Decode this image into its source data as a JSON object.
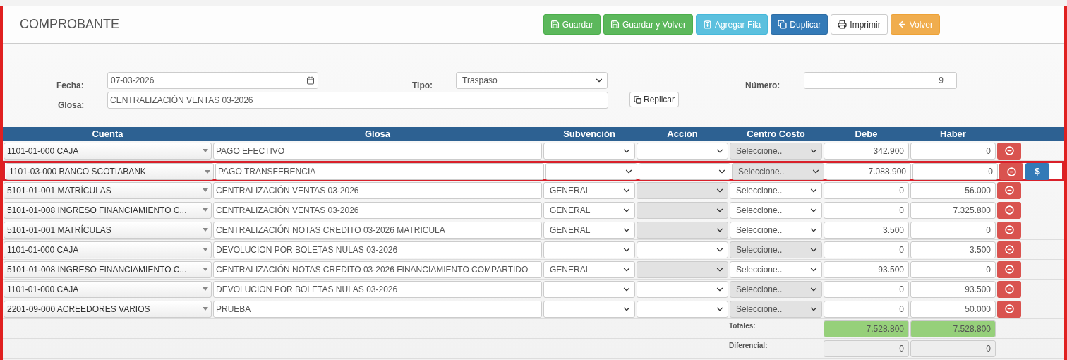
{
  "title": "COMPROBANTE",
  "toolbar": [
    {
      "label": "Guardar",
      "kind": "save"
    },
    {
      "label": "Guardar y Volver",
      "kind": "save"
    },
    {
      "label": "Agregar Fila",
      "kind": "add"
    },
    {
      "label": "Duplicar",
      "kind": "duplicate"
    },
    {
      "label": "Imprimir",
      "kind": "print"
    },
    {
      "label": "Volver",
      "kind": "back"
    }
  ],
  "form": {
    "fecha_label": "Fecha:",
    "fecha": "07-03-2026",
    "tipo_label": "Tipo:",
    "tipo": "Traspaso",
    "numero_label": "Número:",
    "numero": "9",
    "glosa_label": "Glosa:",
    "glosa": "CENTRALIZACIÓN VENTAS 03-2026",
    "replicar": "Replicar"
  },
  "table": {
    "columns": [
      "Cuenta",
      "Glosa",
      "Subvención",
      "Acción",
      "Centro Costo",
      "Debe",
      "Haber"
    ],
    "rows": [
      {
        "cuenta": "1101-01-000 CAJA",
        "glosa": "PAGO EFECTIVO",
        "subvencion": "",
        "accion_disabled": false,
        "centro_costo": "Seleccione..",
        "centro_costo_disabled": true,
        "debe": "342.900",
        "haber": "0",
        "highlighted": false,
        "payment_button": null
      },
      {
        "cuenta": "1101-03-000 BANCO SCOTIABANK",
        "glosa": "PAGO TRANSFERENCIA",
        "subvencion": "",
        "accion_disabled": false,
        "centro_costo": "Seleccione..",
        "centro_costo_disabled": true,
        "debe": "7.088.900",
        "haber": "0",
        "highlighted": true,
        "payment_button": "$"
      },
      {
        "cuenta": "5101-01-001 MATRÍCULAS",
        "glosa": "CENTRALIZACIÓN VENTAS 03-2026",
        "subvencion": "GENERAL",
        "accion_disabled": true,
        "centro_costo": "Seleccione..",
        "centro_costo_disabled": false,
        "debe": "0",
        "haber": "56.000",
        "highlighted": false,
        "payment_button": null
      },
      {
        "cuenta": "5101-01-008 INGRESO FINANCIAMIENTO C...",
        "glosa": "CENTRALIZACIÓN VENTAS 03-2026",
        "subvencion": "GENERAL",
        "accion_disabled": true,
        "centro_costo": "Seleccione..",
        "centro_costo_disabled": false,
        "debe": "0",
        "haber": "7.325.800",
        "highlighted": false,
        "payment_button": null
      },
      {
        "cuenta": "5101-01-001 MATRÍCULAS",
        "glosa": "CENTRALIZACIÓN NOTAS CREDITO 03-2026 MATRICULA",
        "subvencion": "GENERAL",
        "accion_disabled": true,
        "centro_costo": "Seleccione..",
        "centro_costo_disabled": false,
        "debe": "3.500",
        "haber": "0",
        "highlighted": false,
        "payment_button": null
      },
      {
        "cuenta": "1101-01-000 CAJA",
        "glosa": "DEVOLUCION POR BOLETAS NULAS 03-2026",
        "subvencion": "",
        "accion_disabled": false,
        "centro_costo": "Seleccione..",
        "centro_costo_disabled": true,
        "debe": "0",
        "haber": "3.500",
        "highlighted": false,
        "payment_button": null
      },
      {
        "cuenta": "5101-01-008 INGRESO FINANCIAMIENTO C...",
        "glosa": "CENTRALIZACIÓN NOTAS CREDITO 03-2026 FINANCIAMIENTO COMPARTIDO",
        "subvencion": "GENERAL",
        "accion_disabled": true,
        "centro_costo": "Seleccione..",
        "centro_costo_disabled": false,
        "debe": "93.500",
        "haber": "0",
        "highlighted": false,
        "payment_button": null
      },
      {
        "cuenta": "1101-01-000 CAJA",
        "glosa": "DEVOLUCION POR BOLETAS NULAS 03-2026",
        "subvencion": "",
        "accion_disabled": false,
        "centro_costo": "Seleccione..",
        "centro_costo_disabled": true,
        "debe": "0",
        "haber": "93.500",
        "highlighted": false,
        "payment_button": null
      },
      {
        "cuenta": "2201-09-000 ACREEDORES VARIOS",
        "glosa": "PRUEBA",
        "subvencion": "",
        "accion_disabled": false,
        "centro_costo": "Seleccione..",
        "centro_costo_disabled": true,
        "debe": "0",
        "haber": "50.000",
        "highlighted": false,
        "payment_button": null
      }
    ],
    "totals": {
      "label": "Totales:",
      "debe": "7.528.800",
      "haber": "7.528.800"
    },
    "difference": {
      "label": "Diferencial:",
      "debe": "0",
      "haber": "0"
    }
  }
}
